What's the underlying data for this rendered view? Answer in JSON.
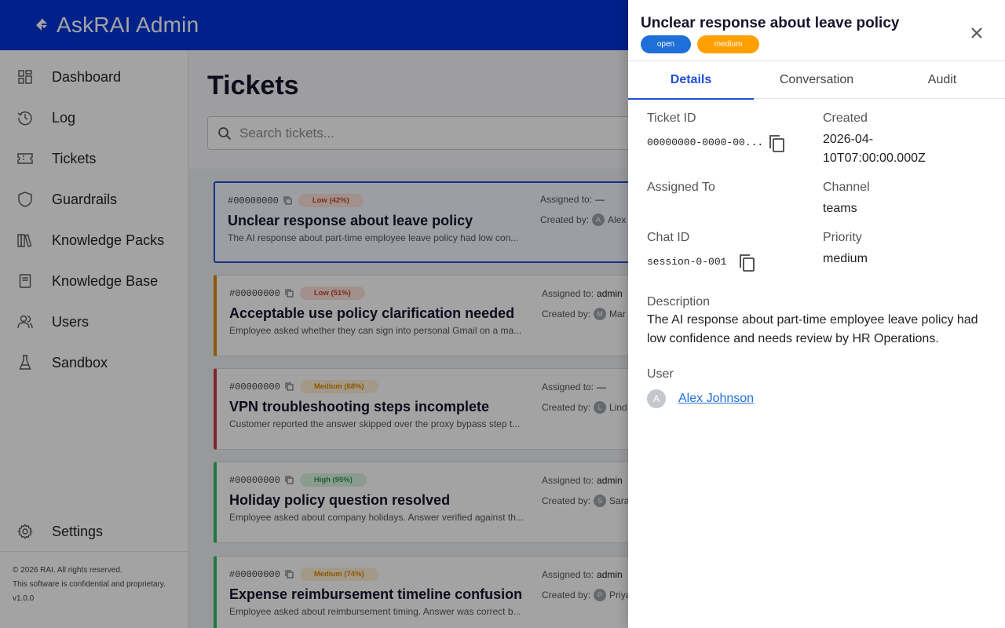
{
  "app": {
    "title": "AskRAI Admin"
  },
  "sidebar": {
    "items": [
      {
        "label": "Dashboard",
        "icon": "dashboard-icon"
      },
      {
        "label": "Log",
        "icon": "history-icon"
      },
      {
        "label": "Tickets",
        "icon": "ticket-icon"
      },
      {
        "label": "Guardrails",
        "icon": "shield-icon"
      },
      {
        "label": "Knowledge Packs",
        "icon": "books-icon"
      },
      {
        "label": "Knowledge Base",
        "icon": "book-icon"
      },
      {
        "label": "Users",
        "icon": "users-icon"
      },
      {
        "label": "Sandbox",
        "icon": "flask-icon"
      }
    ],
    "settings": {
      "label": "Settings",
      "icon": "gear-icon"
    },
    "footer": {
      "copyright": "© 2026 RAI. All rights reserved.",
      "confidential": "This software is confidential and proprietary.",
      "version": "v1.0.0"
    }
  },
  "main": {
    "title": "Tickets",
    "search": {
      "placeholder": "Search tickets..."
    },
    "tickets": [
      {
        "id": "#00000000",
        "confidence": "Low (42%)",
        "level": "low",
        "title": "Unclear response about leave policy",
        "desc": "The AI response about part-time employee leave policy had low con...",
        "assigned_label": "Assigned to:",
        "assigned": "—",
        "created_label": "Created by:",
        "creator_initial": "A",
        "creator": "Alex"
      },
      {
        "id": "#00000000",
        "confidence": "Low (51%)",
        "level": "low",
        "title": "Acceptable use policy clarification needed",
        "desc": "Employee asked whether they can sign into personal Gmail on a ma...",
        "assigned_label": "Assigned to:",
        "assigned": "admin",
        "created_label": "Created by:",
        "creator_initial": "M",
        "creator": "Mar"
      },
      {
        "id": "#00000000",
        "confidence": "Medium (68%)",
        "level": "medium",
        "title": "VPN troubleshooting steps incomplete",
        "desc": "Customer reported the answer skipped over the proxy bypass step t...",
        "assigned_label": "Assigned to:",
        "assigned": "—",
        "created_label": "Created by:",
        "creator_initial": "L",
        "creator": "Lind"
      },
      {
        "id": "#00000000",
        "confidence": "High (95%)",
        "level": "high",
        "title": "Holiday policy question resolved",
        "desc": "Employee asked about company holidays. Answer verified against th...",
        "assigned_label": "Assigned to:",
        "assigned": "admin",
        "created_label": "Created by:",
        "creator_initial": "S",
        "creator": "Sara"
      },
      {
        "id": "#00000000",
        "confidence": "Medium (74%)",
        "level": "medium",
        "title": "Expense reimbursement timeline confusion",
        "desc": "Employee asked about reimbursement timing. Answer was correct b...",
        "assigned_label": "Assigned to:",
        "assigned": "admin",
        "created_label": "Created by:",
        "creator_initial": "P",
        "creator": "Priya"
      }
    ]
  },
  "drawer": {
    "title": "Unclear response about leave policy",
    "status": "open",
    "priority_badge": "medium",
    "tabs": [
      "Details",
      "Conversation",
      "Audit"
    ],
    "fields": {
      "ticket_id_label": "Ticket ID",
      "ticket_id": "00000000-0000-00...",
      "created_label": "Created",
      "created_line1": "2026-04-",
      "created_line2": "10T07:00:00.000Z",
      "assigned_label": "Assigned To",
      "assigned": "",
      "channel_label": "Channel",
      "channel": "teams",
      "chat_id_label": "Chat ID",
      "chat_id": "session-0-001",
      "priority_label": "Priority",
      "priority": "medium",
      "description_label": "Description",
      "description": "The AI response about part-time employee leave policy had low confidence and needs review by HR Operations.",
      "user_label": "User",
      "user_initial": "A",
      "user_name": "Alex Johnson"
    }
  },
  "colors": {
    "brand": "#0035d6",
    "accent": "#1f4fd8",
    "badge_open": "#1f6fd8",
    "badge_medium": "#ffa000",
    "low_border": "#d98a00",
    "medium_border": "#c93b3b",
    "high_border": "#2ebf5f"
  }
}
